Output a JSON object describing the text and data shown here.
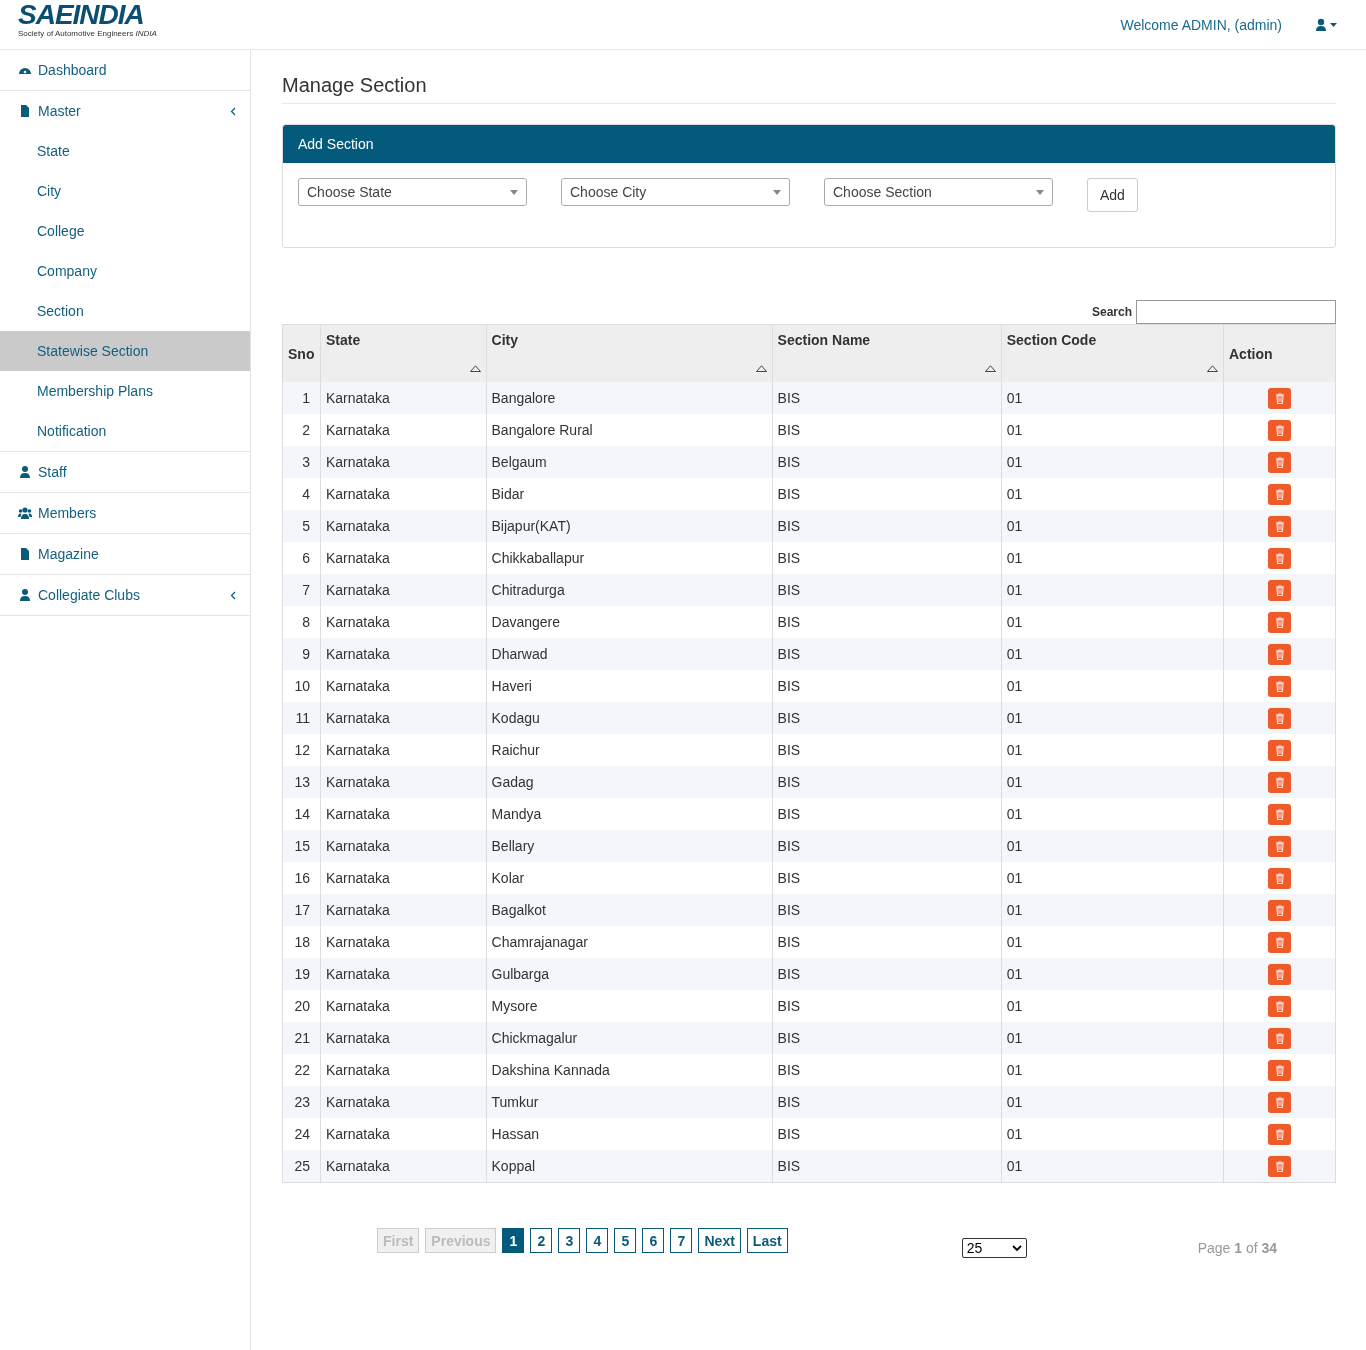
{
  "header": {
    "logo_title": "SAEINDIA",
    "logo_subtitle": "Society of Automotive Engineers *INDIA*",
    "welcome": "Welcome ADMIN, (admin)"
  },
  "sidebar": {
    "items": [
      {
        "label": "Dashboard",
        "selected": false,
        "expandable": false
      },
      {
        "label": "Master",
        "selected": false,
        "expandable": true,
        "children": [
          {
            "label": "State",
            "selected": false
          },
          {
            "label": "City",
            "selected": false
          },
          {
            "label": "College",
            "selected": false
          },
          {
            "label": "Company",
            "selected": false
          },
          {
            "label": "Section",
            "selected": false
          },
          {
            "label": "Statewise Section",
            "selected": true
          },
          {
            "label": "Membership Plans",
            "selected": false
          },
          {
            "label": "Notification",
            "selected": false
          }
        ]
      },
      {
        "label": "Staff",
        "selected": false,
        "expandable": false
      },
      {
        "label": "Members",
        "selected": false,
        "expandable": false
      },
      {
        "label": "Magazine",
        "selected": false,
        "expandable": false
      },
      {
        "label": "Collegiate Clubs",
        "selected": false,
        "expandable": true
      }
    ]
  },
  "page_title": "Manage Section",
  "add_panel": {
    "title": "Add Section",
    "selects": [
      "Choose State",
      "Choose City",
      "Choose Section"
    ],
    "button": "Add"
  },
  "search_label": "Search",
  "table": {
    "columns": [
      {
        "label": "Sno",
        "sortable": false
      },
      {
        "label": "State",
        "sortable": true
      },
      {
        "label": "City",
        "sortable": true
      },
      {
        "label": "Section Name",
        "sortable": true
      },
      {
        "label": "Section Code",
        "sortable": true
      },
      {
        "label": "Action",
        "sortable": false
      }
    ],
    "rows": [
      [
        "1",
        "Karnataka",
        "Bangalore",
        "BIS",
        "01"
      ],
      [
        "2",
        "Karnataka",
        "Bangalore Rural",
        "BIS",
        "01"
      ],
      [
        "3",
        "Karnataka",
        "Belgaum",
        "BIS",
        "01"
      ],
      [
        "4",
        "Karnataka",
        "Bidar",
        "BIS",
        "01"
      ],
      [
        "5",
        "Karnataka",
        "Bijapur(KAT)",
        "BIS",
        "01"
      ],
      [
        "6",
        "Karnataka",
        "Chikkaballapur",
        "BIS",
        "01"
      ],
      [
        "7",
        "Karnataka",
        "Chitradurga",
        "BIS",
        "01"
      ],
      [
        "8",
        "Karnataka",
        "Davangere",
        "BIS",
        "01"
      ],
      [
        "9",
        "Karnataka",
        "Dharwad",
        "BIS",
        "01"
      ],
      [
        "10",
        "Karnataka",
        "Haveri",
        "BIS",
        "01"
      ],
      [
        "11",
        "Karnataka",
        "Kodagu",
        "BIS",
        "01"
      ],
      [
        "12",
        "Karnataka",
        "Raichur",
        "BIS",
        "01"
      ],
      [
        "13",
        "Karnataka",
        "Gadag",
        "BIS",
        "01"
      ],
      [
        "14",
        "Karnataka",
        "Mandya",
        "BIS",
        "01"
      ],
      [
        "15",
        "Karnataka",
        "Bellary",
        "BIS",
        "01"
      ],
      [
        "16",
        "Karnataka",
        "Kolar",
        "BIS",
        "01"
      ],
      [
        "17",
        "Karnataka",
        "Bagalkot",
        "BIS",
        "01"
      ],
      [
        "18",
        "Karnataka",
        "Chamrajanagar",
        "BIS",
        "01"
      ],
      [
        "19",
        "Karnataka",
        "Gulbarga",
        "BIS",
        "01"
      ],
      [
        "20",
        "Karnataka",
        "Mysore",
        "BIS",
        "01"
      ],
      [
        "21",
        "Karnataka",
        "Chickmagalur",
        "BIS",
        "01"
      ],
      [
        "22",
        "Karnataka",
        "Dakshina Kannada",
        "BIS",
        "01"
      ],
      [
        "23",
        "Karnataka",
        "Tumkur",
        "BIS",
        "01"
      ],
      [
        "24",
        "Karnataka",
        "Hassan",
        "BIS",
        "01"
      ],
      [
        "25",
        "Karnataka",
        "Koppal",
        "BIS",
        "01"
      ]
    ]
  },
  "pagination": {
    "buttons": [
      {
        "label": "First",
        "disabled": true,
        "selected": false
      },
      {
        "label": "Previous",
        "disabled": true,
        "selected": false
      },
      {
        "label": "1",
        "disabled": false,
        "selected": true
      },
      {
        "label": "2",
        "disabled": false,
        "selected": false
      },
      {
        "label": "3",
        "disabled": false,
        "selected": false
      },
      {
        "label": "4",
        "disabled": false,
        "selected": false
      },
      {
        "label": "5",
        "disabled": false,
        "selected": false
      },
      {
        "label": "6",
        "disabled": false,
        "selected": false
      },
      {
        "label": "7",
        "disabled": false,
        "selected": false
      },
      {
        "label": "Next",
        "disabled": false,
        "selected": false
      },
      {
        "label": "Last",
        "disabled": false,
        "selected": false
      }
    ],
    "page_size": "25",
    "page_info": "Page **1** of **34**"
  }
}
